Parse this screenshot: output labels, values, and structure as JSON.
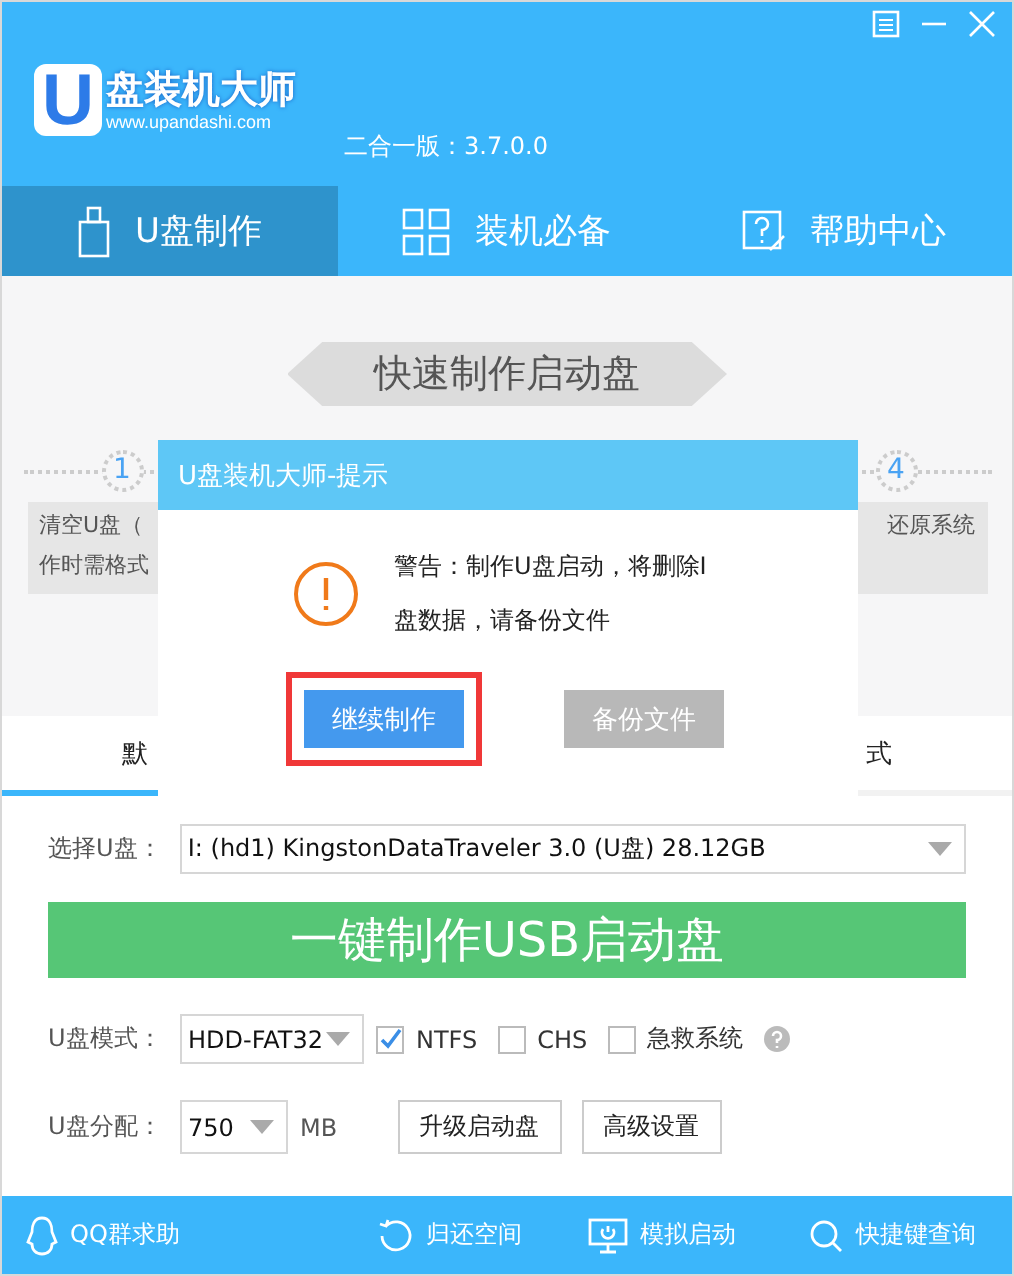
{
  "header": {
    "logo_text": "盘装机大师",
    "logo_letter": "U",
    "logo_url": "www.upandashi.com",
    "version": "二合一版：3.7.0.0"
  },
  "nav_tabs": [
    {
      "label": "U盘制作",
      "selected": true
    },
    {
      "label": "装机必备",
      "selected": false
    },
    {
      "label": "帮助中心",
      "selected": false
    }
  ],
  "banner": {
    "title": "快速制作启动盘"
  },
  "steps": [
    {
      "number": "1",
      "lines": [
        "清空U盘（",
        "作时需格式"
      ]
    },
    {
      "number": "4",
      "lines": [
        "还原系统"
      ]
    }
  ],
  "mode_tabs": [
    {
      "label": "默",
      "selected": true
    },
    {
      "label": "式",
      "selected": false
    }
  ],
  "dialog": {
    "title": "U盘装机大师-提示",
    "message": [
      "警告：制作U盘启动，将删除I",
      "盘数据，请备份文件"
    ],
    "buttons": [
      {
        "label": "继续制作",
        "disabled": false,
        "highlighted": true
      },
      {
        "label": "备份文件",
        "disabled": true,
        "highlighted": false
      }
    ]
  },
  "drive": {
    "label": "选择U盘：",
    "value": "I: (hd1) KingstonDataTraveler 3.0 (U盘) 28.12GB"
  },
  "make_button": "一键制作USB启动盘",
  "mode": {
    "label": "U盘模式：",
    "value": "HDD-FAT32",
    "options": [
      {
        "label": "NTFS",
        "checked": true
      },
      {
        "label": "CHS",
        "checked": false
      },
      {
        "label": "急救系统",
        "checked": false
      }
    ]
  },
  "partition": {
    "label": "U盘分配：",
    "value": "750",
    "unit": "MB",
    "buttons": [
      "升级启动盘",
      "高级设置"
    ]
  },
  "footer": [
    {
      "label": "QQ群求助"
    },
    {
      "label": "归还空间"
    },
    {
      "label": "模拟启动"
    },
    {
      "label": "快捷键查询"
    }
  ]
}
